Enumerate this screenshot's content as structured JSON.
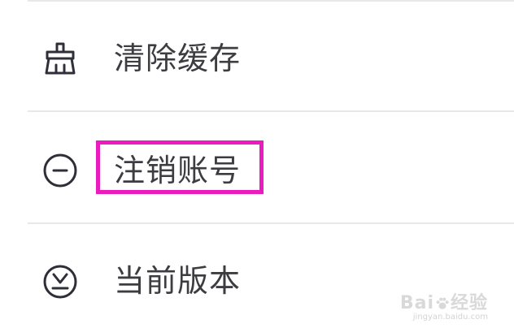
{
  "settings_list": {
    "items": [
      {
        "label": "清除缓存",
        "icon": "broom-icon"
      },
      {
        "label": "注销账号",
        "icon": "minus-circle-icon"
      },
      {
        "label": "当前版本",
        "icon": "version-icon"
      }
    ]
  },
  "highlight": {
    "color": "#e91cc0",
    "target": "注销账号"
  },
  "watermark": {
    "brand_left": "Bai",
    "brand_right": "经验",
    "url": "jingyan.baidu.com"
  },
  "colors": {
    "text": "#3c3c41",
    "icon": "#2f2f3a",
    "divider": "#e8e8ea"
  }
}
